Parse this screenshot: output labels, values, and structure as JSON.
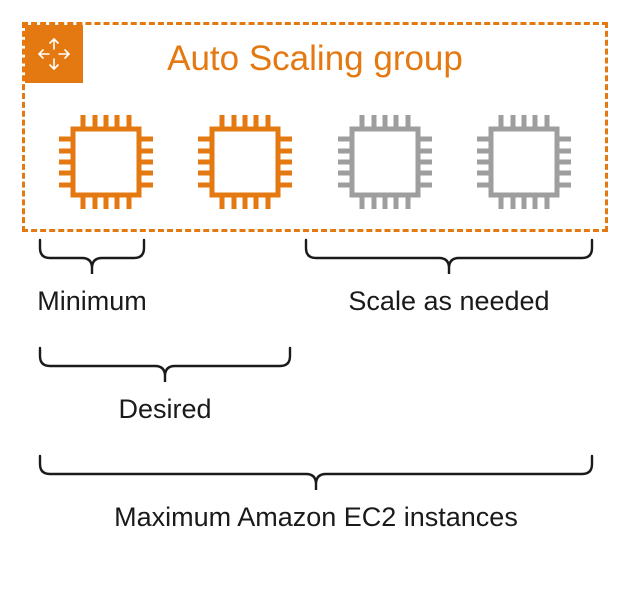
{
  "asg": {
    "title": "Auto Scaling group",
    "icon": "autoscaling-icon"
  },
  "instances": [
    {
      "state": "active"
    },
    {
      "state": "active"
    },
    {
      "state": "potential"
    },
    {
      "state": "potential"
    }
  ],
  "labels": {
    "minimum": "Minimum",
    "scale": "Scale as needed",
    "desired": "Desired",
    "maximum": "Maximum Amazon EC2 instances"
  },
  "colors": {
    "accent": "#e47911",
    "muted": "#9e9e9e",
    "text": "#1a1a1a"
  }
}
